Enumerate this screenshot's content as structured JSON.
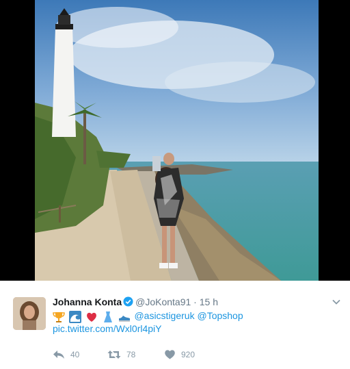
{
  "tweet": {
    "display_name": "Johanna Konta",
    "handle": "@JoKonta91",
    "separator": "·",
    "time": "15 h",
    "emoji_icons": [
      "trophy-icon",
      "wave-icon",
      "heart-icon",
      "dress-icon",
      "sneaker-icon"
    ],
    "mention_1": "@asicstigeruk",
    "mention_2": "@Topshop",
    "pic_link": "pic.twitter.com/Wxl0rl4piY"
  },
  "actions": {
    "reply_count": "40",
    "retweet_count": "78",
    "like_count": "920"
  },
  "colors": {
    "link": "#1b95e0",
    "verified": "#1da1f2",
    "muted": "#657786",
    "action": "#8899a6",
    "heart_emoji": "#dd2e44"
  }
}
